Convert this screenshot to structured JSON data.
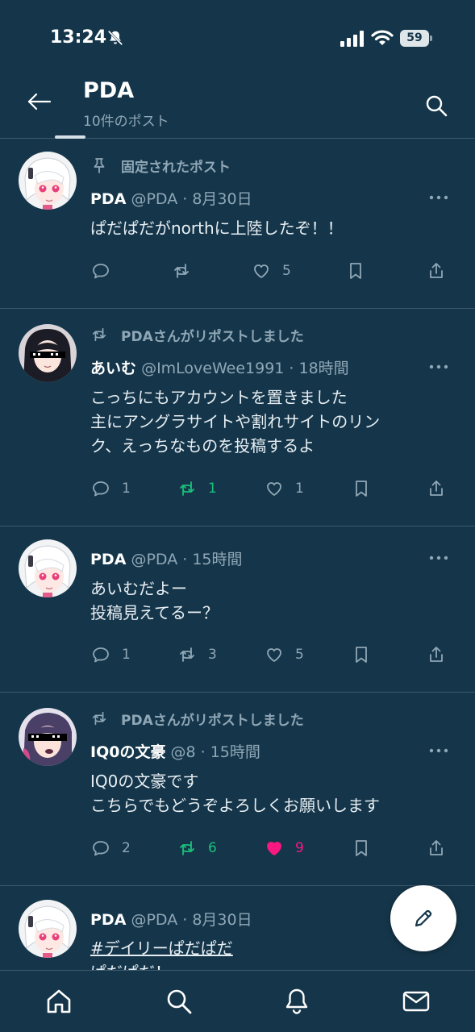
{
  "status": {
    "time": "13:24",
    "battery": "59"
  },
  "header": {
    "title": "PDA",
    "subtitle": "10件のポスト"
  },
  "posts": [
    {
      "context": "固定されたポスト",
      "name": "PDA",
      "meta": "@PDA · 8月30日",
      "lines": [
        "ぱだぱだがnorthに上陸したぞ！！"
      ],
      "reply": "",
      "repost": "",
      "like": "5"
    },
    {
      "context": "PDAさんがリポストしました",
      "name": "あいむ",
      "meta": "@ImLoveWee1991 · 18時間",
      "lines": [
        "こっちにもアカウントを置きました",
        "主にアングラサイトや割れサイトのリン",
        "ク、えっちなものを投稿するよ"
      ],
      "reply": "1",
      "repost": "1",
      "like": "1"
    },
    {
      "context": "",
      "name": "PDA",
      "meta": "@PDA · 15時間",
      "lines": [
        "あいむだよー",
        "投稿見えてるー？"
      ],
      "reply": "1",
      "repost": "3",
      "like": "5"
    },
    {
      "context": "PDAさんがリポストしました",
      "name": "IQ0の文豪",
      "meta": "@8 · 15時間",
      "lines": [
        "IQ0の文豪です",
        "こちらでもどうぞよろしくお願いします"
      ],
      "reply": "2",
      "repost": "6",
      "like": "9"
    },
    {
      "context": "",
      "name": "PDA",
      "meta": "@PDA · 8月30日",
      "lines": [
        "#デイリーぱだぱだ",
        "ぱだぱだ！"
      ],
      "reply": "",
      "repost": "",
      "like": ""
    }
  ],
  "colors": {
    "background": "#15364a",
    "repost_active": "#1bbf7a",
    "like_active": "#f91880"
  },
  "icons": [
    "back-arrow-icon",
    "search-icon",
    "pin-icon",
    "repost-icon",
    "reply-icon",
    "like-icon",
    "bookmark-icon",
    "share-icon",
    "more-icon",
    "compose-icon",
    "home-icon",
    "bell-icon",
    "mail-icon"
  ],
  "nav": [
    "home",
    "search",
    "notifications",
    "messages"
  ]
}
